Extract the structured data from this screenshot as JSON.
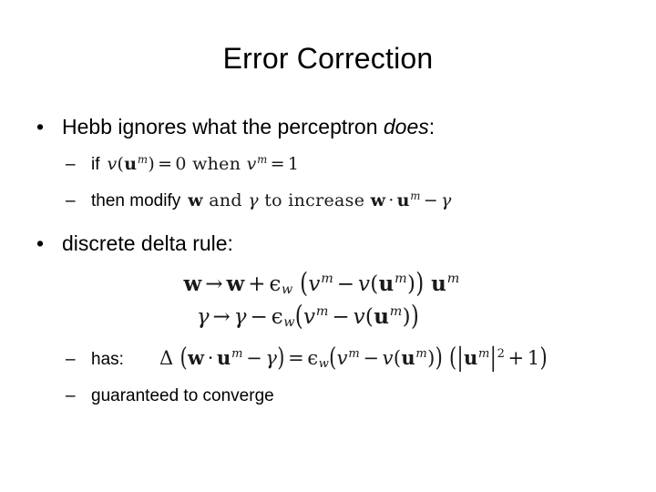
{
  "slide": {
    "title": "Error Correction",
    "background_color": "#ffffff",
    "text_color": "#000000",
    "math_color": "#1a1a1a"
  },
  "bullets": {
    "bullet_glyph": "•",
    "dash_glyph": "–",
    "hebb": {
      "text_before": "Hebb ignores what the perceptron ",
      "emphasis": "does",
      "text_after": ":"
    },
    "if_label": "if",
    "then_label": "then modify",
    "delta_rule": "discrete delta rule:",
    "has_label": "has:",
    "converge_label": "guaranteed to converge"
  },
  "math": {
    "if_condition": {
      "latex": "v(\\mathbf{u}^{m}) = 0 \\;\\text{when}\\; v^{m} = 1",
      "plain": "v(u^m) = 0 when v^m = 1",
      "v": "v",
      "lparen": "(",
      "u": "u",
      "m": "m",
      "rparen": ")",
      "equals": "=",
      "zero": "0",
      "when": "when",
      "one": "1"
    },
    "then_modify": {
      "latex": "\\mathbf{w} \\;\\text{and}\\; \\gamma \\;\\text{to increase}\\; \\mathbf{w}\\cdot\\mathbf{u}^{m} - \\gamma",
      "plain": "w and γ to increase w · u^m − γ",
      "w": "w",
      "and": "and",
      "gamma": "γ",
      "to_increase": "to increase",
      "dot": "·",
      "u": "u",
      "m": "m",
      "minus": "−"
    },
    "equation_1": {
      "latex": "\\mathbf{w} \\rightarrow \\mathbf{w} + \\epsilon_{w}\\left(v^{m} - v(\\mathbf{u}^{m})\\right)\\mathbf{u}^{m}",
      "plain": "w → w + ε_w (v^m − v(u^m)) u^m",
      "w": "w",
      "arrow": "→",
      "plus": "+",
      "epsilon": "ϵ",
      "eps_sub": "w",
      "lparen": "(",
      "v": "v",
      "m": "m",
      "minus": "−",
      "rparen": ")",
      "u": "u"
    },
    "equation_2": {
      "latex": "\\gamma \\rightarrow \\gamma - \\epsilon_{w}(v^{m} - v(\\mathbf{u}^{m}))",
      "plain": "γ → γ − ε_w(v^m − v(u^m))",
      "gamma": "γ",
      "arrow": "→",
      "minus": "−",
      "epsilon": "ϵ",
      "eps_sub": "w",
      "lparen": "(",
      "v": "v",
      "m": "m",
      "rparen": ")",
      "u": "u"
    },
    "equation_3": {
      "latex": "\\Delta\\left(\\mathbf{w}\\cdot\\mathbf{u}^{m} - \\gamma\\right) = \\epsilon_{w}(v^{m} - v(\\mathbf{u}^{m}))\\left(|\\mathbf{u}^{m}|^{2} + 1\\right)",
      "plain": "Δ (w · u^m − γ) = ε_w(v^m − v(u^m)) (|u^m|² + 1)",
      "Delta": "Δ",
      "lparen": "(",
      "w": "w",
      "dot": "·",
      "u": "u",
      "m": "m",
      "minus": "−",
      "gamma": "γ",
      "rparen": ")",
      "equals": "=",
      "epsilon": "ϵ",
      "eps_sub": "w",
      "v": "v",
      "bar": "|",
      "two": "2",
      "plus": "+",
      "one": "1"
    }
  }
}
